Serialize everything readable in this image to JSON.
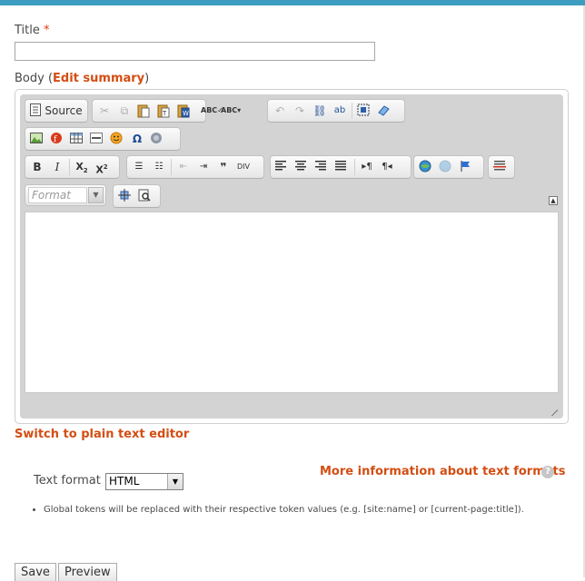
{
  "form": {
    "title_label": "Title",
    "required_mark": "*",
    "title_value": "",
    "body_label_prefix": "Body (",
    "edit_summary_link": "Edit summary",
    "body_label_suffix": ")"
  },
  "toolbar": {
    "source_label": "Source",
    "format_placeholder": "Format",
    "icons": [
      "source-icon",
      "cut-icon",
      "copy-icon",
      "paste-icon",
      "paste-text-icon",
      "paste-word-icon",
      "spellcheck-icon",
      "spellcheck-as-you-type-icon",
      "undo-icon",
      "redo-icon",
      "find-icon",
      "replace-icon",
      "select-all-icon",
      "remove-format-icon",
      "image-icon",
      "flash-icon",
      "table-icon",
      "horizontal-rule-icon",
      "smiley-icon",
      "special-char-icon",
      "iframe-icon",
      "bold-icon",
      "italic-icon",
      "subscript-icon",
      "superscript-icon",
      "numbered-list-icon",
      "bulleted-list-icon",
      "outdent-icon",
      "indent-icon",
      "blockquote-icon",
      "div-icon",
      "align-left-icon",
      "align-center-icon",
      "align-right-icon",
      "justify-icon",
      "ltr-icon",
      "rtl-icon",
      "link-icon",
      "unlink-icon",
      "anchor-icon",
      "page-break-icon",
      "maximize-icon",
      "show-blocks-icon"
    ]
  },
  "editor": {
    "content": ""
  },
  "links": {
    "switch_editor": "Switch to plain text editor",
    "more_info": "More information about text formats"
  },
  "text_format": {
    "label": "Text format",
    "selected": "HTML",
    "tip": "Global tokens will be replaced with their respective token values (e.g. [site:name] or [current-page:title])."
  },
  "actions": {
    "save": "Save",
    "preview": "Preview"
  },
  "colors": {
    "accent_bar": "#3d9dc0",
    "link": "#d34e13",
    "required": "#e0380c"
  }
}
